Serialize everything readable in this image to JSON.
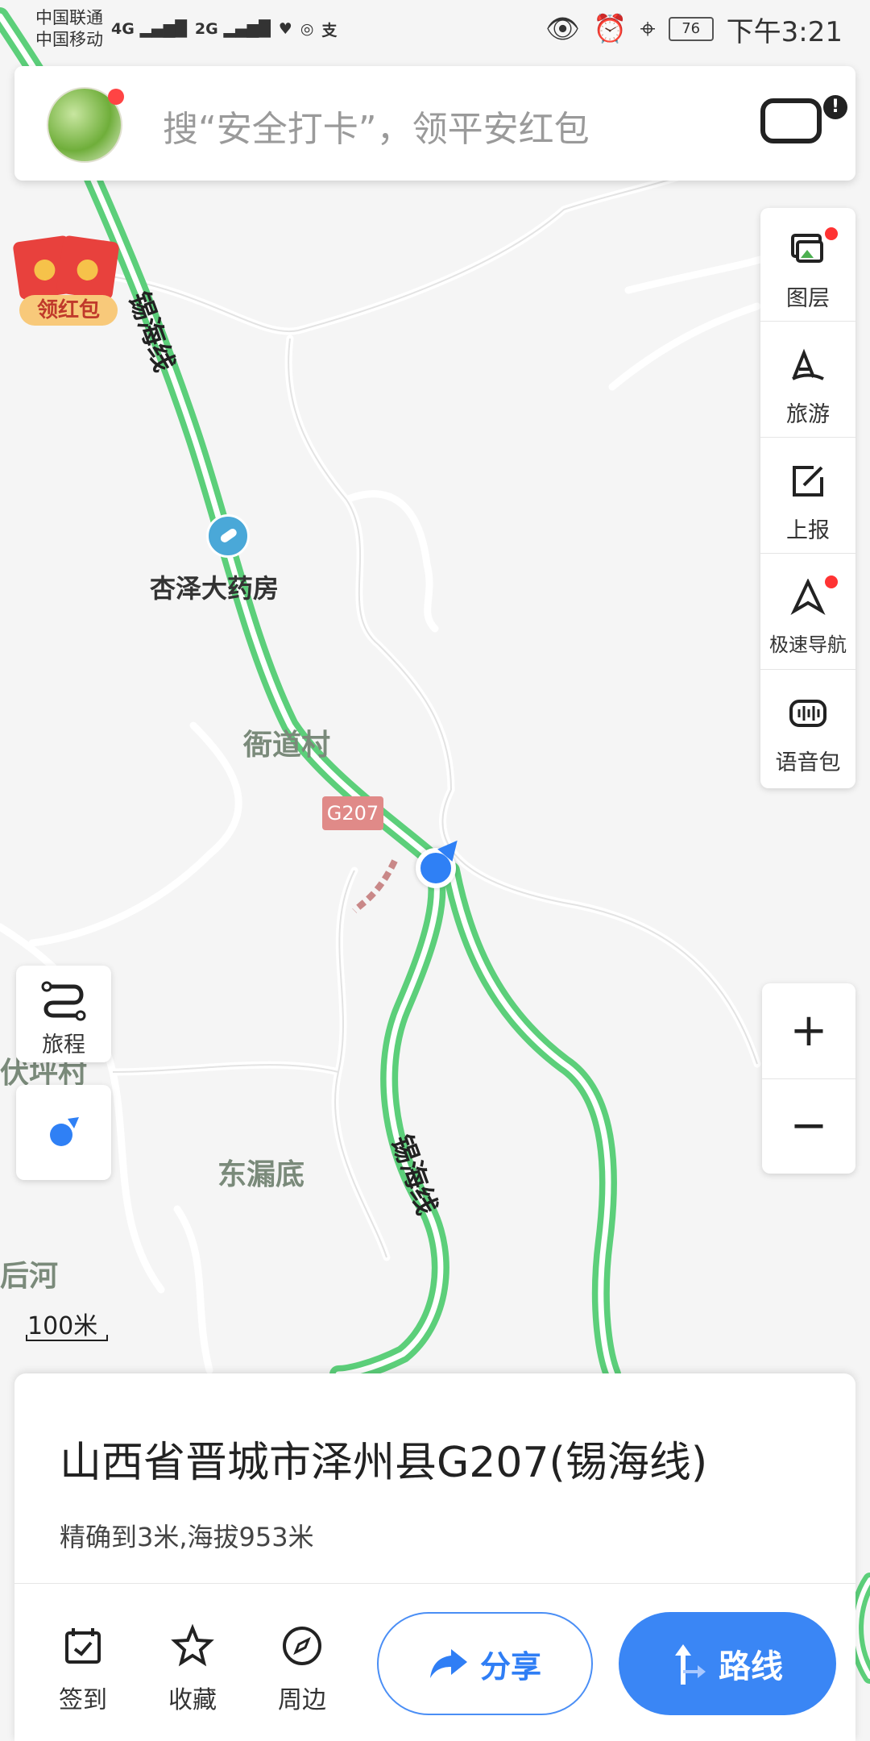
{
  "status_bar": {
    "carrier_1": "中国联通",
    "carrier_2": "中国移动",
    "net_1": "4G",
    "net_2": "2G",
    "battery": "76",
    "time": "下午3:21"
  },
  "search": {
    "placeholder": "搜“安全打卡”，领平安红包"
  },
  "promo": {
    "red_packet_label": "领红包"
  },
  "map": {
    "road_name": "锡海线",
    "road_code": "G207",
    "poi_pharmacy": "杏泽大药房",
    "village_1": "衙道村",
    "village_2": "伏坪村",
    "village_3": "东漏底",
    "village_4": "后河",
    "scale": "100米",
    "colors": {
      "road": "#5ccf7a",
      "accent": "#3a86f5",
      "road_badge": "#e08a88"
    }
  },
  "toolbar": {
    "items": [
      {
        "label": "图层",
        "icon": "layers-icon"
      },
      {
        "label": "旅游",
        "icon": "travel-icon"
      },
      {
        "label": "上报",
        "icon": "report-icon"
      },
      {
        "label": "极速导航",
        "icon": "navigation-icon"
      },
      {
        "label": "语音包",
        "icon": "voice-pack-icon"
      }
    ]
  },
  "trip": {
    "label": "旅程"
  },
  "zoom": {
    "in": "+",
    "out": "−"
  },
  "location_card": {
    "address": "山西省晋城市泽州县G207(锡海线)",
    "precision": "精确到3米,海拔953米"
  },
  "actions": {
    "checkin": "签到",
    "favorite": "收藏",
    "nearby": "周边",
    "share": "分享",
    "route": "路线"
  }
}
